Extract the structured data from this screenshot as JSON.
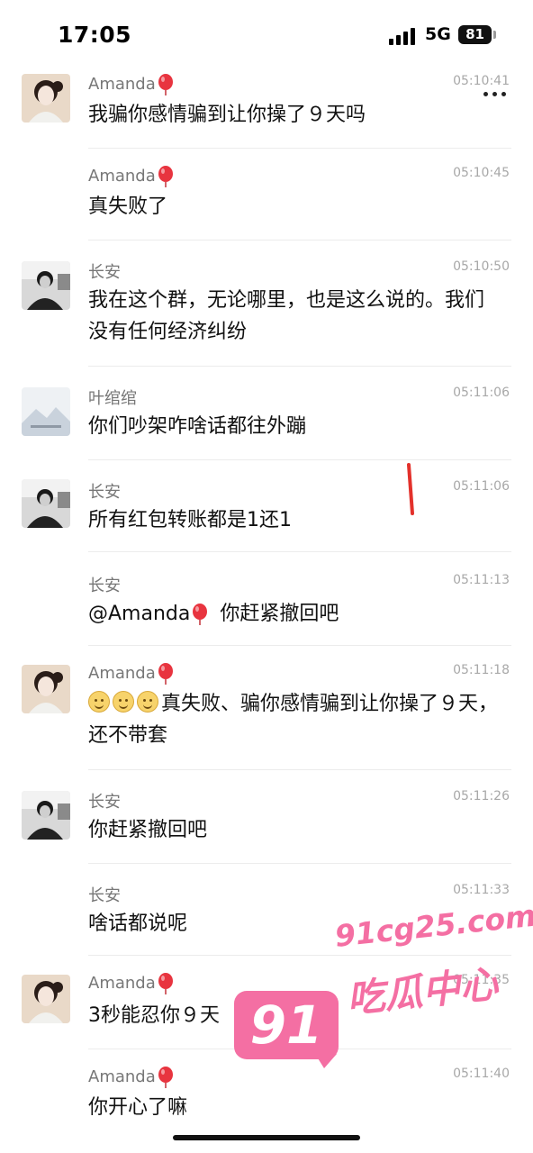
{
  "status_bar": {
    "time": "17:05",
    "network": "5G",
    "battery": "81"
  },
  "messages": [
    {
      "sender": "Amanda",
      "time": "05:10:41",
      "text": "我骗你感情骗到让你操了９天吗"
    },
    {
      "sender": "Amanda",
      "time": "05:10:45",
      "text": "真失败了"
    },
    {
      "sender": "长安",
      "time": "05:10:50",
      "text": "我在这个群，无论哪里，也是这么说的。我们没有任何经济纠纷"
    },
    {
      "sender": "叶绾绾",
      "time": "05:11:06",
      "text": "你们吵架咋啥话都往外蹦"
    },
    {
      "sender": "长安",
      "time": "05:11:06",
      "text": "所有红包转账都是1还1"
    },
    {
      "sender": "长安",
      "time": "05:11:13",
      "text_mention": "@Amanda",
      "text": "你赶紧撤回吧"
    },
    {
      "sender": "Amanda",
      "time": "05:11:18",
      "text": "真失败、骗你感情骗到让你操了９天，还不带套"
    },
    {
      "sender": "长安",
      "time": "05:11:26",
      "text": "你赶紧撤回吧"
    },
    {
      "sender": "长安",
      "time": "05:11:33",
      "text": "啥话都说呢"
    },
    {
      "sender": "Amanda",
      "time": "05:11:35",
      "text": "3秒能忍你９天"
    },
    {
      "sender": "Amanda",
      "time": "05:11:40",
      "text": "你开心了嘛"
    }
  ],
  "watermark": {
    "number": "91",
    "url": "91cg25.com",
    "name": "吃瓜中心"
  },
  "icons": {
    "balloon": "balloon-icon",
    "more": "more-dots-icon",
    "emoji": "smile-emoji-icon"
  },
  "colors": {
    "watermark": "#f46fa3",
    "balloon": "#e8343f",
    "timestamp": "#a8a8a8"
  }
}
